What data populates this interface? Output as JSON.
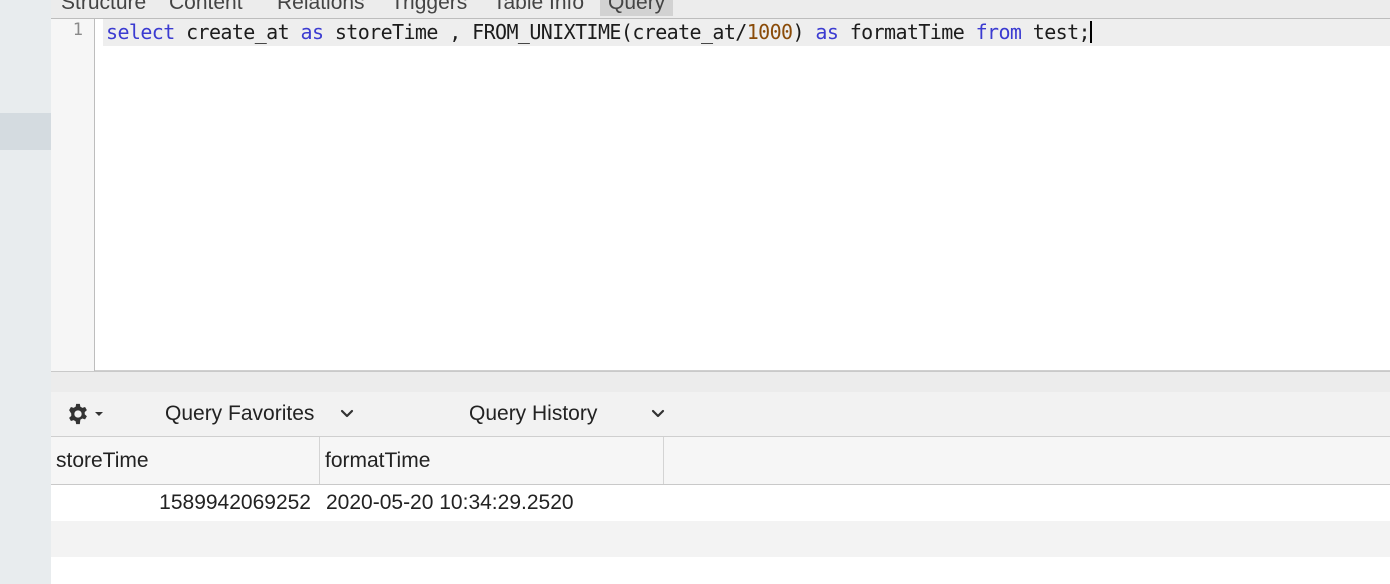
{
  "tabs": [
    {
      "label": "Structure"
    },
    {
      "label": "Content"
    },
    {
      "label": "Relations"
    },
    {
      "label": "Triggers"
    },
    {
      "label": "Table Info"
    },
    {
      "label": "Query"
    }
  ],
  "editor": {
    "line_number": "1",
    "tokens": {
      "t1": "select",
      "t2": " create_at ",
      "t3": "as",
      "t4": " storeTime , FROM_UNIXTIME(create_at/",
      "t5": "1000",
      "t6": ") ",
      "t7": "as",
      "t8": " formatTime ",
      "t9": "from",
      "t10": " test;"
    }
  },
  "toolbar": {
    "gear_icon": "gear-icon",
    "favorites_label": "Query Favorites",
    "history_label": "Query History"
  },
  "results": {
    "columns": [
      "storeTime",
      "formatTime"
    ],
    "rows": [
      [
        "1589942069252",
        "2020-05-20 10:34:29.2520"
      ]
    ]
  },
  "colors": {
    "keyword": "#3b3bd1",
    "number": "#8a4b08",
    "active_tab": "#d2d2d2"
  }
}
